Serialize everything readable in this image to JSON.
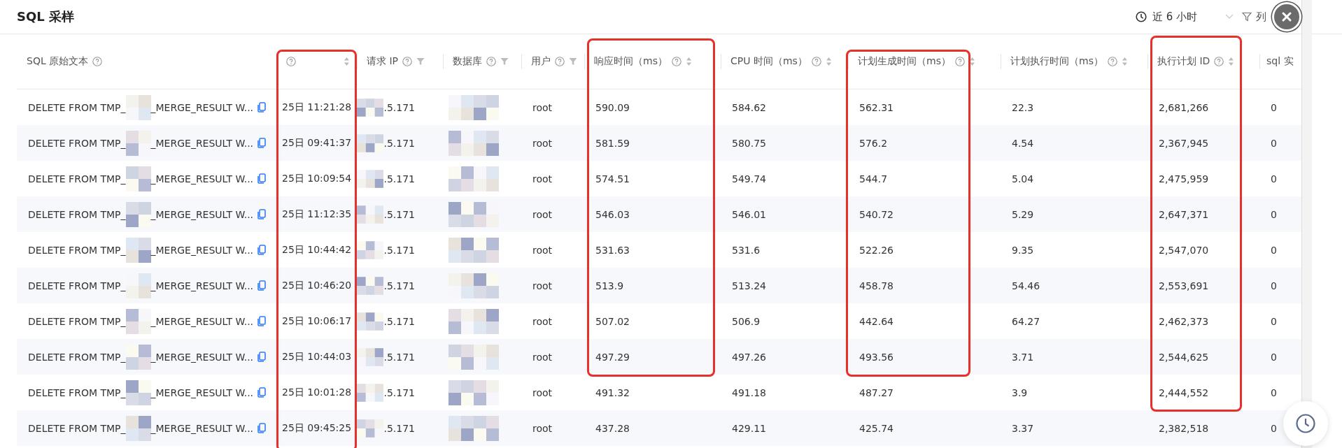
{
  "title": "SQL 采样",
  "toolbar": {
    "time_range": "近 6 小时",
    "column_button": "列"
  },
  "table": {
    "columns": [
      {
        "label": "SQL 原始文本",
        "help": true,
        "sort": false,
        "filter": false
      },
      {
        "help": true,
        "sort": true,
        "filter": false
      },
      {
        "label": "请求 IP",
        "help": true,
        "sort": false,
        "filter": true
      },
      {
        "label": "数据库",
        "help": true,
        "sort": false,
        "filter": true
      },
      {
        "label": "用户",
        "help": true,
        "sort": false,
        "filter": true
      },
      {
        "label": "响应时间（ms）",
        "help": true,
        "sort": true,
        "filter": false
      },
      {
        "label": "CPU 时间（ms）",
        "help": true,
        "sort": true,
        "filter": false
      },
      {
        "label": "计划生成时间（ms）",
        "help": true,
        "sort": true,
        "filter": false
      },
      {
        "label": "计划执行时间（ms）",
        "help": true,
        "sort": true,
        "filter": false
      },
      {
        "label": "执行计划 ID",
        "help": true,
        "sort": true,
        "filter": false
      },
      {
        "label": "sql 实",
        "help": false,
        "sort": false,
        "filter": false
      }
    ],
    "rows": [
      {
        "sql_start": "DELETE FROM TMP_",
        "sql_end": "_MERGE_RESULT W...",
        "time": "25日 11:21:28",
        "ip": ".5.171",
        "user": "root",
        "response_time": "590.09",
        "cpu_time": "584.62",
        "plan_gen_time": "562.31",
        "plan_exec_time": "22.3",
        "plan_id": "2,681,266",
        "column_11": "0"
      },
      {
        "sql_start": "DELETE FROM TMP_",
        "sql_end": "_MERGE_RESULT W...",
        "time": "25日 09:41:37",
        "ip": ".5.171",
        "user": "root",
        "response_time": "581.59",
        "cpu_time": "580.75",
        "plan_gen_time": "576.2",
        "plan_exec_time": "4.54",
        "plan_id": "2,367,945",
        "column_11": "0"
      },
      {
        "sql_start": "DELETE FROM TMP_",
        "sql_end": "_MERGE_RESULT W...",
        "time": "25日 10:09:54",
        "ip": ".5.171",
        "user": "root",
        "response_time": "574.51",
        "cpu_time": "549.74",
        "plan_gen_time": "544.7",
        "plan_exec_time": "5.04",
        "plan_id": "2,475,959",
        "column_11": "0"
      },
      {
        "sql_start": "DELETE FROM TMP_",
        "sql_end": "_MERGE_RESULT W...",
        "time": "25日 11:12:35",
        "ip": ".5.171",
        "user": "root",
        "response_time": "546.03",
        "cpu_time": "546.01",
        "plan_gen_time": "540.72",
        "plan_exec_time": "5.29",
        "plan_id": "2,647,371",
        "column_11": "0"
      },
      {
        "sql_start": "DELETE FROM TMP_",
        "sql_end": "_MERGE_RESULT W...",
        "time": "25日 10:44:42",
        "ip": ".5.171",
        "user": "root",
        "response_time": "531.63",
        "cpu_time": "531.6",
        "plan_gen_time": "522.26",
        "plan_exec_time": "9.35",
        "plan_id": "2,547,070",
        "column_11": "0"
      },
      {
        "sql_start": "DELETE FROM TMP_",
        "sql_end": "_MERGE_RESULT W...",
        "time": "25日 10:46:20",
        "ip": ".5.171",
        "user": "root",
        "response_time": "513.9",
        "cpu_time": "513.24",
        "plan_gen_time": "458.78",
        "plan_exec_time": "54.46",
        "plan_id": "2,553,691",
        "column_11": "0"
      },
      {
        "sql_start": "DELETE FROM TMP_",
        "sql_end": "_MERGE_RESULT W...",
        "time": "25日 10:06:17",
        "ip": ".5.171",
        "user": "root",
        "response_time": "507.02",
        "cpu_time": "506.9",
        "plan_gen_time": "442.64",
        "plan_exec_time": "64.27",
        "plan_id": "2,462,373",
        "column_11": "0"
      },
      {
        "sql_start": "DELETE FROM TMP_",
        "sql_end": "_MERGE_RESULT W...",
        "time": "25日 10:44:03",
        "ip": ".5.171",
        "user": "root",
        "response_time": "497.29",
        "cpu_time": "497.26",
        "plan_gen_time": "493.56",
        "plan_exec_time": "3.71",
        "plan_id": "2,544,625",
        "column_11": "0"
      },
      {
        "sql_start": "DELETE FROM TMP_",
        "sql_end": "_MERGE_RESULT W...",
        "time": "25日 10:01:28",
        "ip": ".5.171",
        "user": "root",
        "response_time": "491.32",
        "cpu_time": "491.18",
        "plan_gen_time": "487.27",
        "plan_exec_time": "3.9",
        "plan_id": "2,444,552",
        "column_11": "0"
      },
      {
        "sql_start": "DELETE FROM TMP_",
        "sql_end": "_MERGE_RESULT W...",
        "time": "25日 09:45:25",
        "ip": ".5.171",
        "user": "root",
        "response_time": "437.28",
        "cpu_time": "429.11",
        "plan_gen_time": "425.74",
        "plan_exec_time": "3.37",
        "plan_id": "2,382,518",
        "column_11": "0"
      }
    ]
  }
}
